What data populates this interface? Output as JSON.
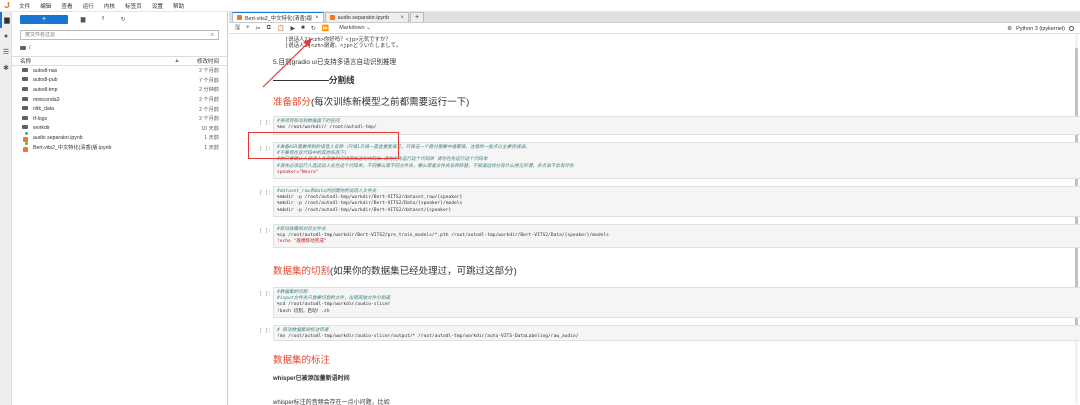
{
  "menubar": {
    "items": [
      "文件",
      "编辑",
      "查看",
      "运行",
      "内核",
      "标签页",
      "设置",
      "帮助"
    ]
  },
  "rail": {
    "icons": [
      "folder-icon",
      "running-icon",
      "list-icon",
      "puzzle-icon"
    ]
  },
  "browser": {
    "new_label": "+",
    "search_placeholder": "按文件名过滤",
    "breadcrumb": "/",
    "col_name": "名称",
    "col_time": "修改时间",
    "files": [
      {
        "name": "autodl-nas",
        "time": "2 个月前",
        "type": "folder"
      },
      {
        "name": "autodl-pub",
        "time": "7 个月前",
        "type": "folder"
      },
      {
        "name": "autodl-tmp",
        "time": "2 分钟前",
        "type": "folder"
      },
      {
        "name": "miniconda3",
        "time": "2 个月前",
        "type": "folder"
      },
      {
        "name": "nltk_data",
        "time": "2 个月前",
        "type": "folder"
      },
      {
        "name": "tf-logs",
        "time": "2 个月前",
        "type": "folder"
      },
      {
        "name": "workdir",
        "time": "10 天前",
        "type": "folder"
      },
      {
        "name": "audio separator.ipynb",
        "time": "1 天前",
        "type": "notebook"
      },
      {
        "name": "Bert-vits2_中文特化(清香)版.ipynb",
        "time": "1 天前",
        "type": "notebook"
      }
    ]
  },
  "tabs": [
    {
      "label": "Bert-vits2_中文特化(清香)版",
      "active": true
    },
    {
      "label": "audio separator.ipynb",
      "active": false
    }
  ],
  "toolbar": {
    "cell_type": "Markdown",
    "kernel": "Python 3 (ipykernel)"
  },
  "notebook": {
    "top_lines": [
      "[说话人2]<zh>你好吗？<jp>元気ですか？",
      "[说话人3]<zh>谢谢。<jp>どういたしまして。"
    ],
    "item5": "5.目前gradio ui已支持多语言自动识别推理",
    "divider": "分割线",
    "prep_red": "准备部分",
    "prep_black": "(每次训练新模型之前都需要运行一下)",
    "cell1_prompt": "[ ]:",
    "cell1": [
      {
        "t": "#将项目移动到数据盘下的空间",
        "c": "cmt"
      },
      {
        "t": "%mv /root/workdir/ /root/autodl-tmp/",
        "c": ""
      }
    ],
    "cell2_prompt": "[ ]:",
    "cell2": [
      {
        "t": "#准备ASR需要用到的语音人名称（只填1只填一直盒重复填写，只保证一个稳分需要中途都填，注意的一些点以主要存成误。",
        "c": "cmt"
      },
      {
        "t": "#不要再在这代码中的其他东西下)",
        "c": "cmt"
      },
      {
        "t": "#你只要确认人说话人名存放时间请添加这句代码加 请勿在先运行这个代码单 请勿在先运行这个代码单",
        "c": "cmt"
      },
      {
        "t": "#请先必须运行人选这说人名在这个代码单，不同要么简不同文件夹，要么简者文件夹名称移替，不知道这样分有什么用无所谓，多点击不会有坏处",
        "c": "cmt"
      },
      {
        "t": "speaker=\"Neuro\"",
        "c": "str"
      }
    ],
    "cell3_prompt": "[ ]:",
    "cell3": [
      {
        "t": "#dataset_raw和data内创建你的说话人文件夹",
        "c": "cmt"
      },
      {
        "t": "%mkdir -p /root/autodl-tmp/workdir/Bert-VITS2/dataset_raw/{speaker}",
        "c": ""
      },
      {
        "t": "%mkdir -p /root/autodl-tmp/workdir/Bert-VITS2/Data/{speaker}/models",
        "c": ""
      },
      {
        "t": "%mkdir -p /root/autodl-tmp/workdir/Bert-VITS2/dataset/{speaker}",
        "c": ""
      }
    ],
    "cell4_prompt": "[ ]:",
    "cell4": [
      {
        "t": "#移动底模到对应文件夹",
        "c": "cmt"
      },
      {
        "t": "%cp /root/autodl-tmp/workdir/Bert-VITS2/pre_train_models/*.pth /root/autodl-tmp/workdir/Bert-VITS2/Data/{speaker}/models",
        "c": ""
      },
      {
        "t": "!echo \"底模移动完成\"",
        "c": "str"
      }
    ],
    "seg_red": "数据集的切割",
    "seg_black": "(如果你的数据集已经处理过，可跳过这部分)",
    "cell5_prompt": "[ ]:",
    "cell5": [
      {
        "t": "#数据集的切割",
        "c": "cmt"
      },
      {
        "t": "#input文件夹只放要切割的文件，出错再放文件分割箱",
        "c": "cmt"
      },
      {
        "t": "%cd /root/autodl-tmp/workdir/audio-slicer",
        "c": ""
      },
      {
        "t": "!bash 切割，启动！.sh",
        "c": ""
      }
    ],
    "cell6_prompt": "[ ]:",
    "cell6": [
      {
        "t": "# 移动数据集到标注目录",
        "c": "cmt"
      },
      {
        "t": "!mv /root/autodl-tmp/workdir/audio-slicer/output/* /root/autodl-tmp/workdir/auto-VITS-DataLabeling/raw_audio/",
        "c": ""
      }
    ],
    "label_red": "数据集的标注",
    "whisper_bold": "whisper已被添加量新语时间",
    "whisper_note": "whisper标注的音频会存在一点小问题，比如"
  },
  "colors": {
    "accent": "#1976d2",
    "red_heading": "#e8452c",
    "highlight": "#e53935",
    "orange": "#f37726"
  }
}
